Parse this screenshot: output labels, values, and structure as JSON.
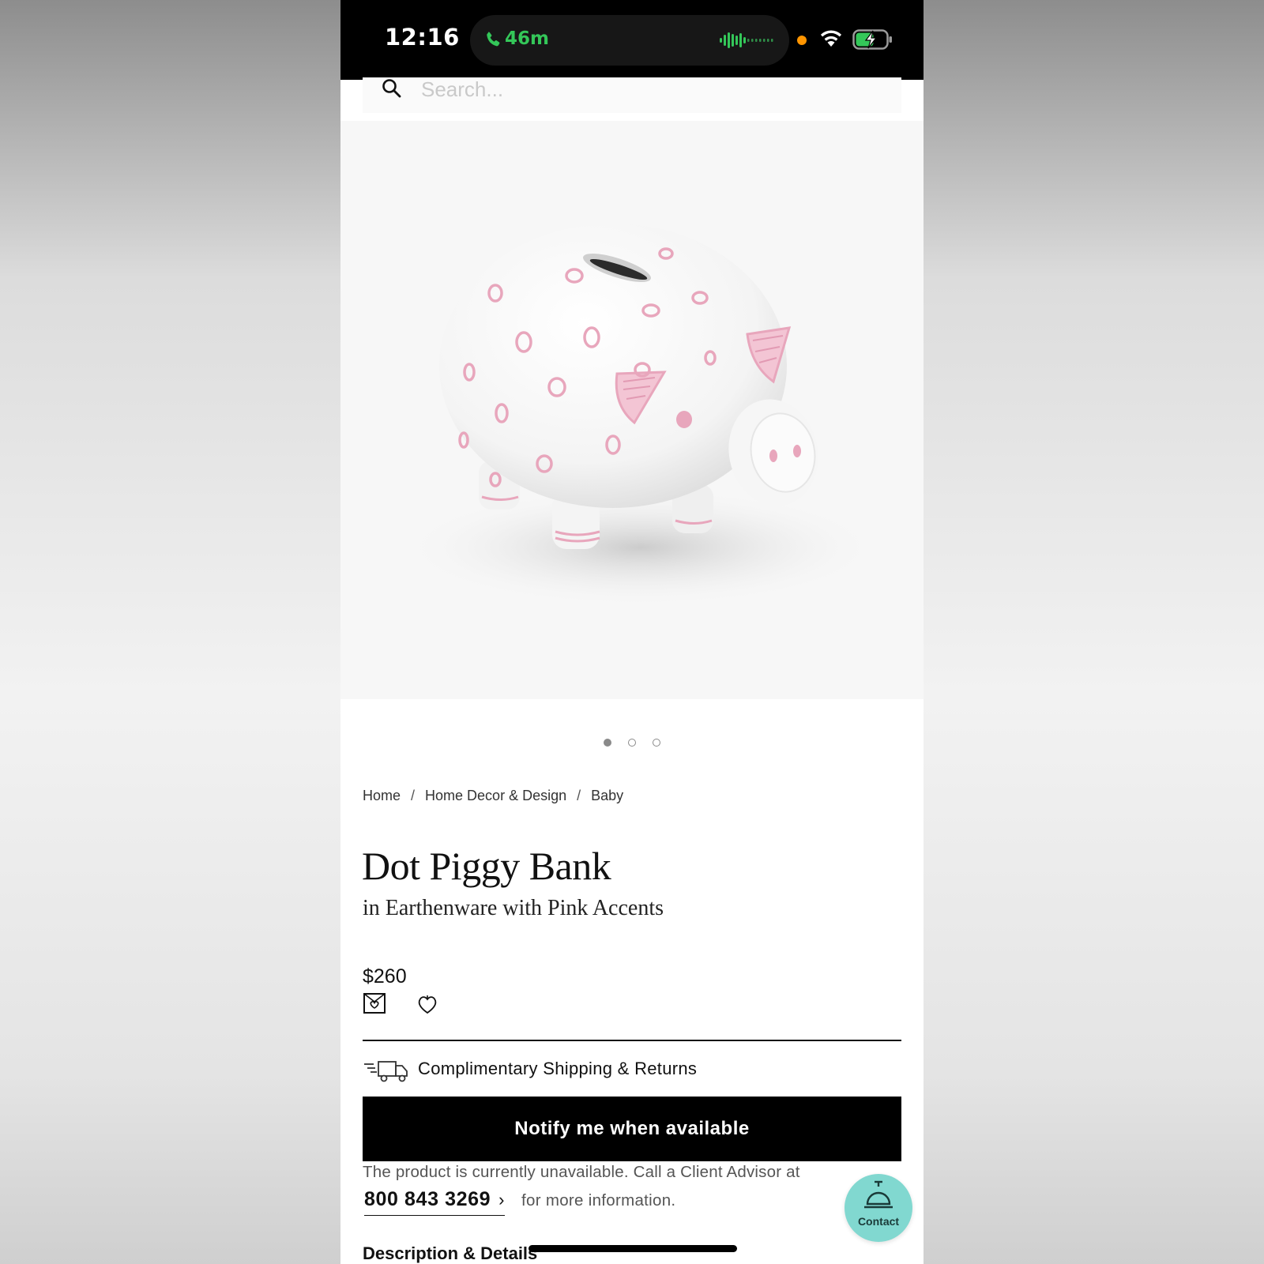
{
  "status_bar": {
    "time": "12:16",
    "call_duration": "46m",
    "call_color": "#34c759",
    "recording_dot_color": "#ff9500",
    "icons": [
      "phone-icon",
      "waveform-icon",
      "wifi-icon",
      "battery-charging-icon"
    ]
  },
  "search": {
    "placeholder": "Search..."
  },
  "gallery": {
    "image": "piggy-bank-photo",
    "total_slides": 3,
    "active_slide": 1
  },
  "breadcrumb": {
    "items": [
      "Home",
      "Home Decor & Design",
      "Baby"
    ],
    "separator": "/"
  },
  "product": {
    "title": "Dot Piggy Bank",
    "subtitle": "in Earthenware with Pink Accents",
    "price": "$260"
  },
  "shipping": {
    "label": "Complimentary Shipping & Returns"
  },
  "notify": {
    "label": "Notify me when available"
  },
  "availability": {
    "message": "The product is currently unavailable. Call a Client Advisor at",
    "phone": "800 843 3269",
    "chevron": "›",
    "suffix": "for more information."
  },
  "contact": {
    "label": "Contact",
    "color": "#81d8d0"
  },
  "description": {
    "heading": "Description & Details"
  }
}
